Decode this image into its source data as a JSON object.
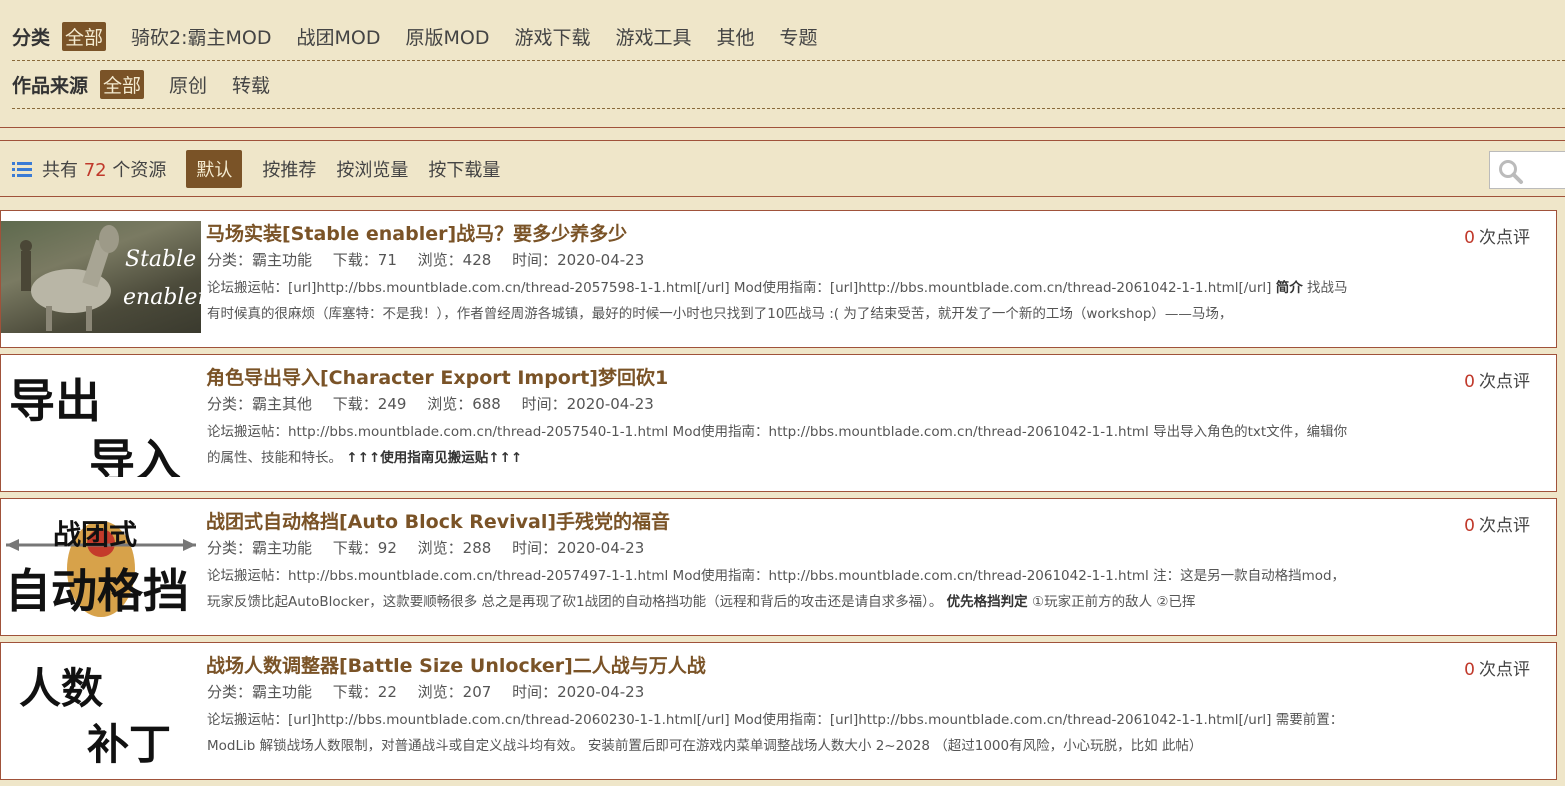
{
  "filters": {
    "category_label": "分类",
    "category_options": [
      "全部",
      "骑砍2:霸主MOD",
      "战团MOD",
      "原版MOD",
      "游戏下载",
      "游戏工具",
      "其他",
      "专题"
    ],
    "source_label": "作品来源",
    "source_options": [
      "全部",
      "原创",
      "转载"
    ]
  },
  "sort_bar": {
    "count_prefix": "共有",
    "count": "72",
    "count_suffix": "个资源",
    "sort_options": [
      "默认",
      "按推荐",
      "按浏览量",
      "按下载量"
    ]
  },
  "items": [
    {
      "thumb_text": [
        "Stable",
        "enabler"
      ],
      "title": "马场实装[Stable enabler]战马？要多少养多少",
      "category": "分类：霸主功能",
      "downloads": "下载：71",
      "views": "浏览：428",
      "time": "时间：2020-04-23",
      "desc_1": "论坛搬运帖：[url]http://bbs.mountblade.com.cn/thread-2057598-1-1.html[/url] Mod使用指南：[url]http://bbs.mountblade.com.cn/thread-2061042-1-1.html[/url]",
      "desc_bold": "简介",
      "desc_2": "找战马有时候真的很麻烦（库塞特：不是我！），作者曾经周游各城镇，最好的时候一小时也只找到了10匹战马 :( 为了结束受苦，就开发了一个新的工场（workshop）——马场，",
      "comment_count": "0",
      "comment_label": "次点评"
    },
    {
      "thumb_text": [
        "导出",
        "导入"
      ],
      "title": "角色导出导入[Character Export Import]梦回砍1",
      "category": "分类：霸主其他",
      "downloads": "下载：249",
      "views": "浏览：688",
      "time": "时间：2020-04-23",
      "desc_1": "论坛搬运帖：http://bbs.mountblade.com.cn/thread-2057540-1-1.html Mod使用指南：http://bbs.mountblade.com.cn/thread-2061042-1-1.html 导出导入角色的txt文件，编辑你的属性、技能和特长。",
      "desc_bold": "↑↑↑使用指南见搬运贴↑↑↑",
      "desc_2": "",
      "comment_count": "0",
      "comment_label": "次点评"
    },
    {
      "thumb_text": [
        "战团式",
        "自动格挡"
      ],
      "title": "战团式自动格挡[Auto Block Revival]手残党的福音",
      "category": "分类：霸主功能",
      "downloads": "下载：92",
      "views": "浏览：288",
      "time": "时间：2020-04-23",
      "desc_1": "论坛搬运帖：http://bbs.mountblade.com.cn/thread-2057497-1-1.html Mod使用指南：http://bbs.mountblade.com.cn/thread-2061042-1-1.html 注：这是另一款自动格挡mod，玩家反馈比起AutoBlocker，这款要顺畅很多 总之是再现了砍1战团的自动格挡功能（远程和背后的攻击还是请自求多福）。",
      "desc_bold": "优先格挡判定",
      "desc_2": "①玩家正前方的敌人 ②已挥",
      "comment_count": "0",
      "comment_label": "次点评"
    },
    {
      "thumb_text": [
        "人数",
        "补丁"
      ],
      "title": "战场人数调整器[Battle Size Unlocker]二人战与万人战",
      "category": "分类：霸主功能",
      "downloads": "下载：22",
      "views": "浏览：207",
      "time": "时间：2020-04-23",
      "desc_1": "论坛搬运帖：[url]http://bbs.mountblade.com.cn/thread-2060230-1-1.html[/url] Mod使用指南：[url]http://bbs.mountblade.com.cn/thread-2061042-1-1.html[/url] 需要前置：ModLib 解锁战场人数限制，对普通战斗或自定义战斗均有效。 安装前置后即可在游戏内菜单调整战场人数大小 2~2028 （超过1000有风险，小心玩脱，比如 此帖）",
      "desc_bold": "",
      "desc_2": "",
      "comment_count": "0",
      "comment_label": "次点评"
    }
  ]
}
